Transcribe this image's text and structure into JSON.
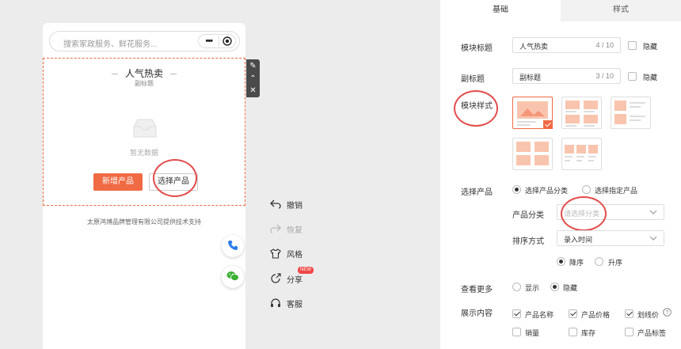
{
  "preview": {
    "search_placeholder": "搜索家政服务、鲜花服务...",
    "capsule_dots": "•••",
    "module": {
      "title": "人气热卖",
      "subtitle": "副标题",
      "empty_text": "暂无数据",
      "add_button": "新增产品",
      "select_button": "选择产品"
    },
    "footer": "太原鸿博品牌管理有限公司提供技术支持"
  },
  "edit_bar": {
    "edit": "✎",
    "up": "⌃",
    "close": "✕"
  },
  "actions": [
    {
      "label": "撤销",
      "icon": "undo-icon"
    },
    {
      "label": "恢复",
      "icon": "redo-icon"
    },
    {
      "label": "风格",
      "icon": "shirt-icon"
    },
    {
      "label": "分享",
      "icon": "share-icon",
      "badge": "NEW"
    },
    {
      "label": "客服",
      "icon": "headset-icon"
    }
  ],
  "panel": {
    "tabs": [
      {
        "label": "基础"
      },
      {
        "label": "样式"
      }
    ],
    "module_title": {
      "label": "模块标题",
      "value": "人气热卖",
      "count": "4 / 10",
      "hide_label": "隐藏"
    },
    "subtitle": {
      "label": "副标题",
      "value": "副标题",
      "count": "3 / 10",
      "hide_label": "隐藏"
    },
    "module_style": {
      "label": "模块样式"
    },
    "select_product": {
      "label": "选择产品",
      "option_category": "选择产品分类",
      "option_specific": "选择指定产品"
    },
    "product_category": {
      "label": "产品分类",
      "placeholder": "请选择分类"
    },
    "sort": {
      "label": "排序方式",
      "value": "录入时间",
      "desc": "降序",
      "asc": "升序"
    },
    "view_more": {
      "label": "查看更多",
      "show": "显示",
      "hide": "隐藏"
    },
    "display": {
      "label": "展示内容",
      "options": [
        "产品名称",
        "产品价格",
        "划线价",
        "销量",
        "库存",
        "产品标签"
      ],
      "checked": [
        true,
        true,
        true,
        false,
        false,
        false
      ]
    }
  },
  "colors": {
    "accent": "#f06a43",
    "annotation": "#e34b4b",
    "phone_blue": "#2b7de9",
    "wechat_green": "#3cb034"
  }
}
